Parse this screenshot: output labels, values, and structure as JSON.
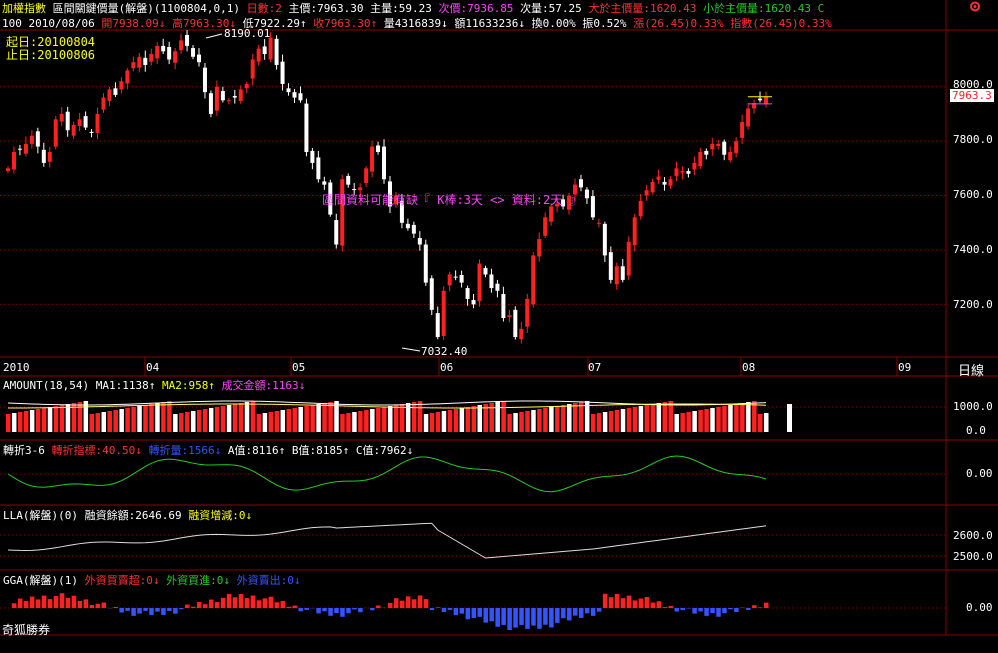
{
  "header": {
    "name": "加權指數",
    "indicator": "區間關鍵價量(解盤)(1100804,0,1)",
    "days_label": "日數:2",
    "main_price": "主價:7963.30",
    "main_qty": "主量:59.23",
    "sub_price": "次價:7936.85",
    "sub_qty": "次量:57.25",
    "above_main": "大於主價量:1620.43",
    "below_main": "小於主價量:1620.43",
    "corner_icon": "C"
  },
  "quote_row": {
    "period": "100",
    "date": "2010/08/06",
    "open": "開7938.09↓",
    "high": "高7963.30↓",
    "low": "低7922.29↑",
    "close": "收7963.30↑",
    "volume": "量4316839↓",
    "amount": "額11633236↓",
    "turnover": "換0.00%",
    "amplitude": "振0.52%",
    "change": "漲(26.45)0.33%",
    "index_change": "指數(26.45)0.33%"
  },
  "range": {
    "start": "起日:20100804",
    "end": "止日:20100806"
  },
  "annotations": {
    "high_label": "8190.01",
    "low_label": "7032.40",
    "gap_text": "區間資料可能有缺『 K棒:3天 <> 資料:2天 』",
    "price_tag": "7963.3"
  },
  "x_axis_labels": [
    "2010",
    "04",
    "05",
    "06",
    "07",
    "08",
    "09"
  ],
  "scale_button": "日線",
  "panels": {
    "amount": {
      "name": "AMOUNT(18,54)",
      "ma1": "MA1:1138↑",
      "ma2": "MA2:958↑",
      "total": "成交金額:1163↓",
      "ticks": [
        "1000.0",
        "0.0"
      ]
    },
    "turn": {
      "name": "轉折3-6",
      "indicator": "轉折指標:40.50↓",
      "qty": "轉折量:1566↓",
      "a": "A值:8116↑",
      "b": "B值:8185↑",
      "c": "C值:7962↓",
      "ticks": [
        "0.00"
      ]
    },
    "lla": {
      "name": "LLA(解盤)(0)",
      "balance": "融資餘額:2646.69",
      "change": "融資增減:0↓",
      "ticks": [
        "2600.0",
        "2500.0"
      ]
    },
    "gga": {
      "name": "GGA(解盤)(1)",
      "net": "外資買賣超:0↓",
      "buy": "外資買進:0↓",
      "sell": "外資賣出:0↓",
      "ticks": [
        "0.00"
      ]
    }
  },
  "footer": "奇狐勝券",
  "colors": {
    "up": "#ff2020",
    "down": "#ffffff",
    "grid": "#8b0000",
    "yellow": "#ffff00",
    "magenta": "#ff40ff",
    "green": "#22cc22",
    "blue": "#3355ff",
    "ma2": "#ffff66"
  },
  "chart_data": {
    "type": "candlestick",
    "price_ticks": [
      7200,
      7400,
      7600,
      7800,
      8000
    ],
    "price_range": [
      7032.4,
      8190.01
    ],
    "last_close": 7963.3
  }
}
